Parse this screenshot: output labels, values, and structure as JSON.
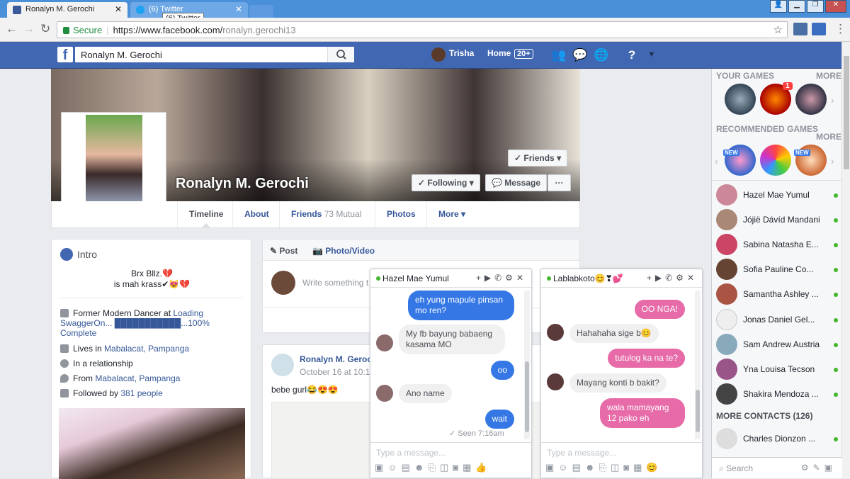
{
  "browser": {
    "tabs": [
      {
        "title": "Ronalyn M. Gerochi",
        "color": "#3b5998"
      },
      {
        "title": "(6) Twitter",
        "color": "#1da1f2"
      }
    ],
    "tooltip": "(6) Twitter",
    "address": {
      "secure_label": "Secure",
      "url_main": "https://www.facebook.com/",
      "url_path": "ronalyn.gerochi13"
    }
  },
  "fb": {
    "search_value": "Ronalyn M. Gerochi",
    "user_name": "Trisha",
    "home_label": "Home",
    "home_badge": "20+",
    "accent": "#4267b2"
  },
  "profile": {
    "name": "Ronalyn M. Gerochi",
    "friends_btn": "Friends",
    "following_btn": "Following",
    "message_btn": "Message",
    "more_btn": "···",
    "nav": {
      "timeline": "Timeline",
      "about": "About",
      "friends": "Friends",
      "friends_mutual": "73 Mutual",
      "photos": "Photos",
      "more": "More"
    }
  },
  "intro": {
    "title": "Intro",
    "bio_line1": "Brx Bllz.💔",
    "bio_line2": "is mah krass✔😻💔",
    "work_prefix": "Former Modern Dancer at ",
    "work_link": "Loading SwaggerOn... ███████████...100% Complete",
    "lives_prefix": "Lives in ",
    "lives_link": "Mabalacat, Pampanga",
    "relationship": "In a relationship",
    "from_prefix": "From ",
    "from_link": "Mabalacat, Pampanga",
    "followed_prefix": "Followed by ",
    "followed_link": "381 people"
  },
  "composer": {
    "post_tab": "Post",
    "photo_tab": "Photo/Video",
    "placeholder": "Write something t"
  },
  "post": {
    "author": "Ronalyn M. Geroc",
    "date": "October 16 at 10:1",
    "text": "bebe gurl😂😍😍"
  },
  "chat1": {
    "name": "Hazel Mae Yumul",
    "messages": [
      {
        "from": "me",
        "text": "eh yung mapule pinsan mo ren?"
      },
      {
        "from": "them",
        "text": "My fb bayung babaeng kasama MO"
      },
      {
        "from": "me",
        "text": "oo"
      },
      {
        "from": "them",
        "text": "Ano name"
      },
      {
        "from": "me",
        "text": "wait"
      }
    ],
    "seen": "✓ Seen 7:16am",
    "input_placeholder": "Type a message..."
  },
  "chat2": {
    "name": "Lablabkoto😊❣💕",
    "messages": [
      {
        "from": "me",
        "text": "OO NGA!"
      },
      {
        "from": "them",
        "text": "Hahahaha sige b😊"
      },
      {
        "from": "me",
        "text": "tutulog ka na te?"
      },
      {
        "from": "them",
        "text": "Mayang konti b bakit?"
      },
      {
        "from": "me",
        "text": "wala mamayang 12 pako eh"
      }
    ],
    "input_placeholder": "Type a message..."
  },
  "sidebar": {
    "your_games": "YOUR GAMES",
    "more1": "MORE",
    "game_badge": "1",
    "recommended": "RECOMMENDED GAMES",
    "more2": "MORE",
    "new_tag": "NEW",
    "contacts": [
      "Hazel Mae Yumul",
      "Jójië Dávíd Mandani",
      "Sabina Natasha E...",
      "Sofia Pauline Co...",
      "Samantha Ashley ...",
      "Jonas Daniel Gel...",
      "Sam Andrew Austria",
      "Yna Louisa Tecson",
      "Shakira Mendoza ..."
    ],
    "more_contacts": "MORE CONTACTS (126)",
    "more_contact_1": "Charles Dionzon ...",
    "search": "Search"
  }
}
